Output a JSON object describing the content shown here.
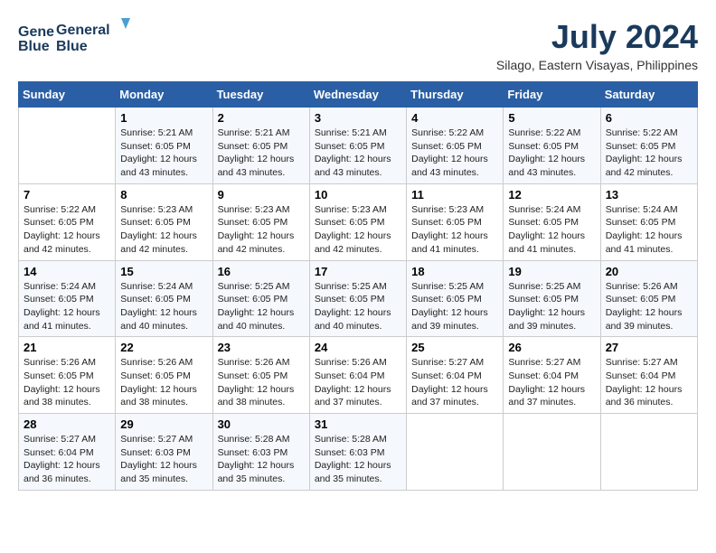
{
  "logo": {
    "line1": "General",
    "line2": "Blue"
  },
  "title": "July 2024",
  "location": "Silago, Eastern Visayas, Philippines",
  "days_of_week": [
    "Sunday",
    "Monday",
    "Tuesday",
    "Wednesday",
    "Thursday",
    "Friday",
    "Saturday"
  ],
  "weeks": [
    [
      {
        "day": "",
        "content": ""
      },
      {
        "day": "1",
        "content": "Sunrise: 5:21 AM\nSunset: 6:05 PM\nDaylight: 12 hours\nand 43 minutes."
      },
      {
        "day": "2",
        "content": "Sunrise: 5:21 AM\nSunset: 6:05 PM\nDaylight: 12 hours\nand 43 minutes."
      },
      {
        "day": "3",
        "content": "Sunrise: 5:21 AM\nSunset: 6:05 PM\nDaylight: 12 hours\nand 43 minutes."
      },
      {
        "day": "4",
        "content": "Sunrise: 5:22 AM\nSunset: 6:05 PM\nDaylight: 12 hours\nand 43 minutes."
      },
      {
        "day": "5",
        "content": "Sunrise: 5:22 AM\nSunset: 6:05 PM\nDaylight: 12 hours\nand 43 minutes."
      },
      {
        "day": "6",
        "content": "Sunrise: 5:22 AM\nSunset: 6:05 PM\nDaylight: 12 hours\nand 42 minutes."
      }
    ],
    [
      {
        "day": "7",
        "content": "Sunrise: 5:22 AM\nSunset: 6:05 PM\nDaylight: 12 hours\nand 42 minutes."
      },
      {
        "day": "8",
        "content": "Sunrise: 5:23 AM\nSunset: 6:05 PM\nDaylight: 12 hours\nand 42 minutes."
      },
      {
        "day": "9",
        "content": "Sunrise: 5:23 AM\nSunset: 6:05 PM\nDaylight: 12 hours\nand 42 minutes."
      },
      {
        "day": "10",
        "content": "Sunrise: 5:23 AM\nSunset: 6:05 PM\nDaylight: 12 hours\nand 42 minutes."
      },
      {
        "day": "11",
        "content": "Sunrise: 5:23 AM\nSunset: 6:05 PM\nDaylight: 12 hours\nand 41 minutes."
      },
      {
        "day": "12",
        "content": "Sunrise: 5:24 AM\nSunset: 6:05 PM\nDaylight: 12 hours\nand 41 minutes."
      },
      {
        "day": "13",
        "content": "Sunrise: 5:24 AM\nSunset: 6:05 PM\nDaylight: 12 hours\nand 41 minutes."
      }
    ],
    [
      {
        "day": "14",
        "content": "Sunrise: 5:24 AM\nSunset: 6:05 PM\nDaylight: 12 hours\nand 41 minutes."
      },
      {
        "day": "15",
        "content": "Sunrise: 5:24 AM\nSunset: 6:05 PM\nDaylight: 12 hours\nand 40 minutes."
      },
      {
        "day": "16",
        "content": "Sunrise: 5:25 AM\nSunset: 6:05 PM\nDaylight: 12 hours\nand 40 minutes."
      },
      {
        "day": "17",
        "content": "Sunrise: 5:25 AM\nSunset: 6:05 PM\nDaylight: 12 hours\nand 40 minutes."
      },
      {
        "day": "18",
        "content": "Sunrise: 5:25 AM\nSunset: 6:05 PM\nDaylight: 12 hours\nand 39 minutes."
      },
      {
        "day": "19",
        "content": "Sunrise: 5:25 AM\nSunset: 6:05 PM\nDaylight: 12 hours\nand 39 minutes."
      },
      {
        "day": "20",
        "content": "Sunrise: 5:26 AM\nSunset: 6:05 PM\nDaylight: 12 hours\nand 39 minutes."
      }
    ],
    [
      {
        "day": "21",
        "content": "Sunrise: 5:26 AM\nSunset: 6:05 PM\nDaylight: 12 hours\nand 38 minutes."
      },
      {
        "day": "22",
        "content": "Sunrise: 5:26 AM\nSunset: 6:05 PM\nDaylight: 12 hours\nand 38 minutes."
      },
      {
        "day": "23",
        "content": "Sunrise: 5:26 AM\nSunset: 6:05 PM\nDaylight: 12 hours\nand 38 minutes."
      },
      {
        "day": "24",
        "content": "Sunrise: 5:26 AM\nSunset: 6:04 PM\nDaylight: 12 hours\nand 37 minutes."
      },
      {
        "day": "25",
        "content": "Sunrise: 5:27 AM\nSunset: 6:04 PM\nDaylight: 12 hours\nand 37 minutes."
      },
      {
        "day": "26",
        "content": "Sunrise: 5:27 AM\nSunset: 6:04 PM\nDaylight: 12 hours\nand 37 minutes."
      },
      {
        "day": "27",
        "content": "Sunrise: 5:27 AM\nSunset: 6:04 PM\nDaylight: 12 hours\nand 36 minutes."
      }
    ],
    [
      {
        "day": "28",
        "content": "Sunrise: 5:27 AM\nSunset: 6:04 PM\nDaylight: 12 hours\nand 36 minutes."
      },
      {
        "day": "29",
        "content": "Sunrise: 5:27 AM\nSunset: 6:03 PM\nDaylight: 12 hours\nand 35 minutes."
      },
      {
        "day": "30",
        "content": "Sunrise: 5:28 AM\nSunset: 6:03 PM\nDaylight: 12 hours\nand 35 minutes."
      },
      {
        "day": "31",
        "content": "Sunrise: 5:28 AM\nSunset: 6:03 PM\nDaylight: 12 hours\nand 35 minutes."
      },
      {
        "day": "",
        "content": ""
      },
      {
        "day": "",
        "content": ""
      },
      {
        "day": "",
        "content": ""
      }
    ]
  ]
}
